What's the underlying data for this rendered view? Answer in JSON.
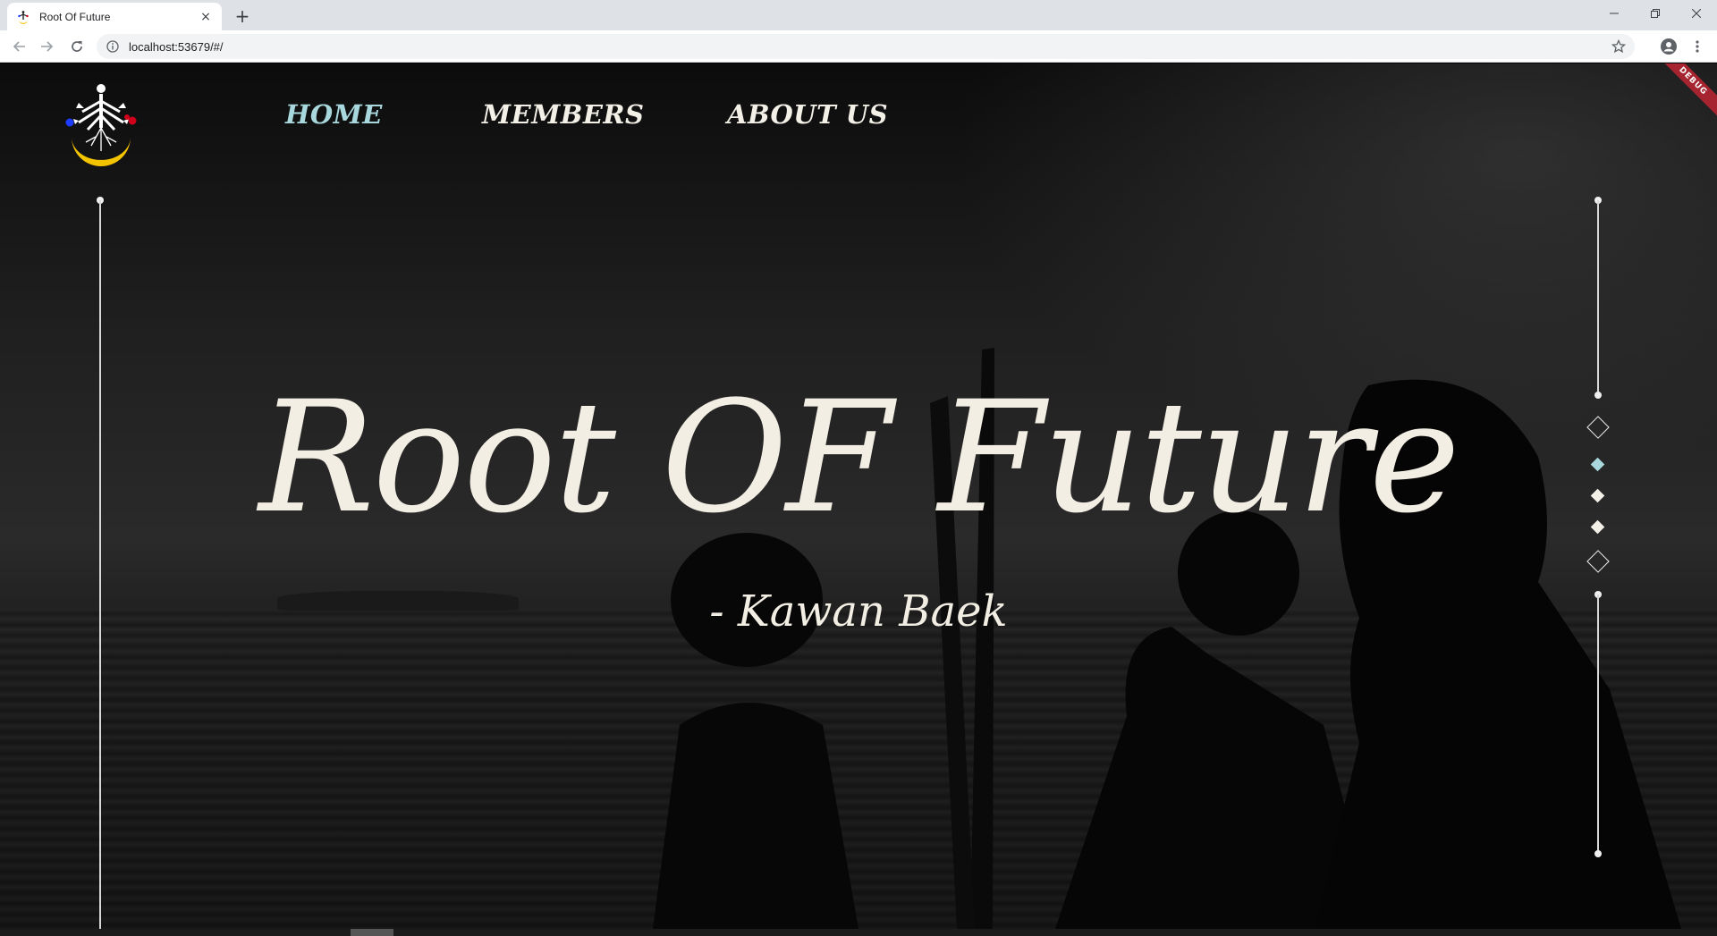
{
  "browser": {
    "tab_title": "Root Of Future",
    "tab_close": "×",
    "new_tab": "+",
    "url": "localhost:53679/#/",
    "icons": {
      "back": "arrow-left-icon",
      "forward": "arrow-right-icon",
      "reload": "reload-icon",
      "info": "info-icon",
      "bookmark": "star-icon",
      "profile": "account-icon",
      "menu": "kebab-menu-icon",
      "minimize": "minimize-icon",
      "restore": "restore-icon",
      "close": "close-icon"
    }
  },
  "page": {
    "debug_label": "DEBUG",
    "nav": {
      "items": [
        {
          "label": "HOME",
          "active": true
        },
        {
          "label": "MEMBERS",
          "active": false
        },
        {
          "label": "ABOUT US",
          "active": false
        }
      ]
    },
    "hero": {
      "title": "Root OF Future",
      "subtitle": "- Kawan Baek"
    },
    "pager": {
      "count": 3,
      "active_index": 0
    },
    "colors": {
      "accent": "#a8d8dd",
      "text": "#f3eee4",
      "logo_moon": "#f5c400",
      "logo_red": "#d0021b",
      "logo_blue": "#1e3cff",
      "debug_banner": "#a5242f"
    }
  }
}
